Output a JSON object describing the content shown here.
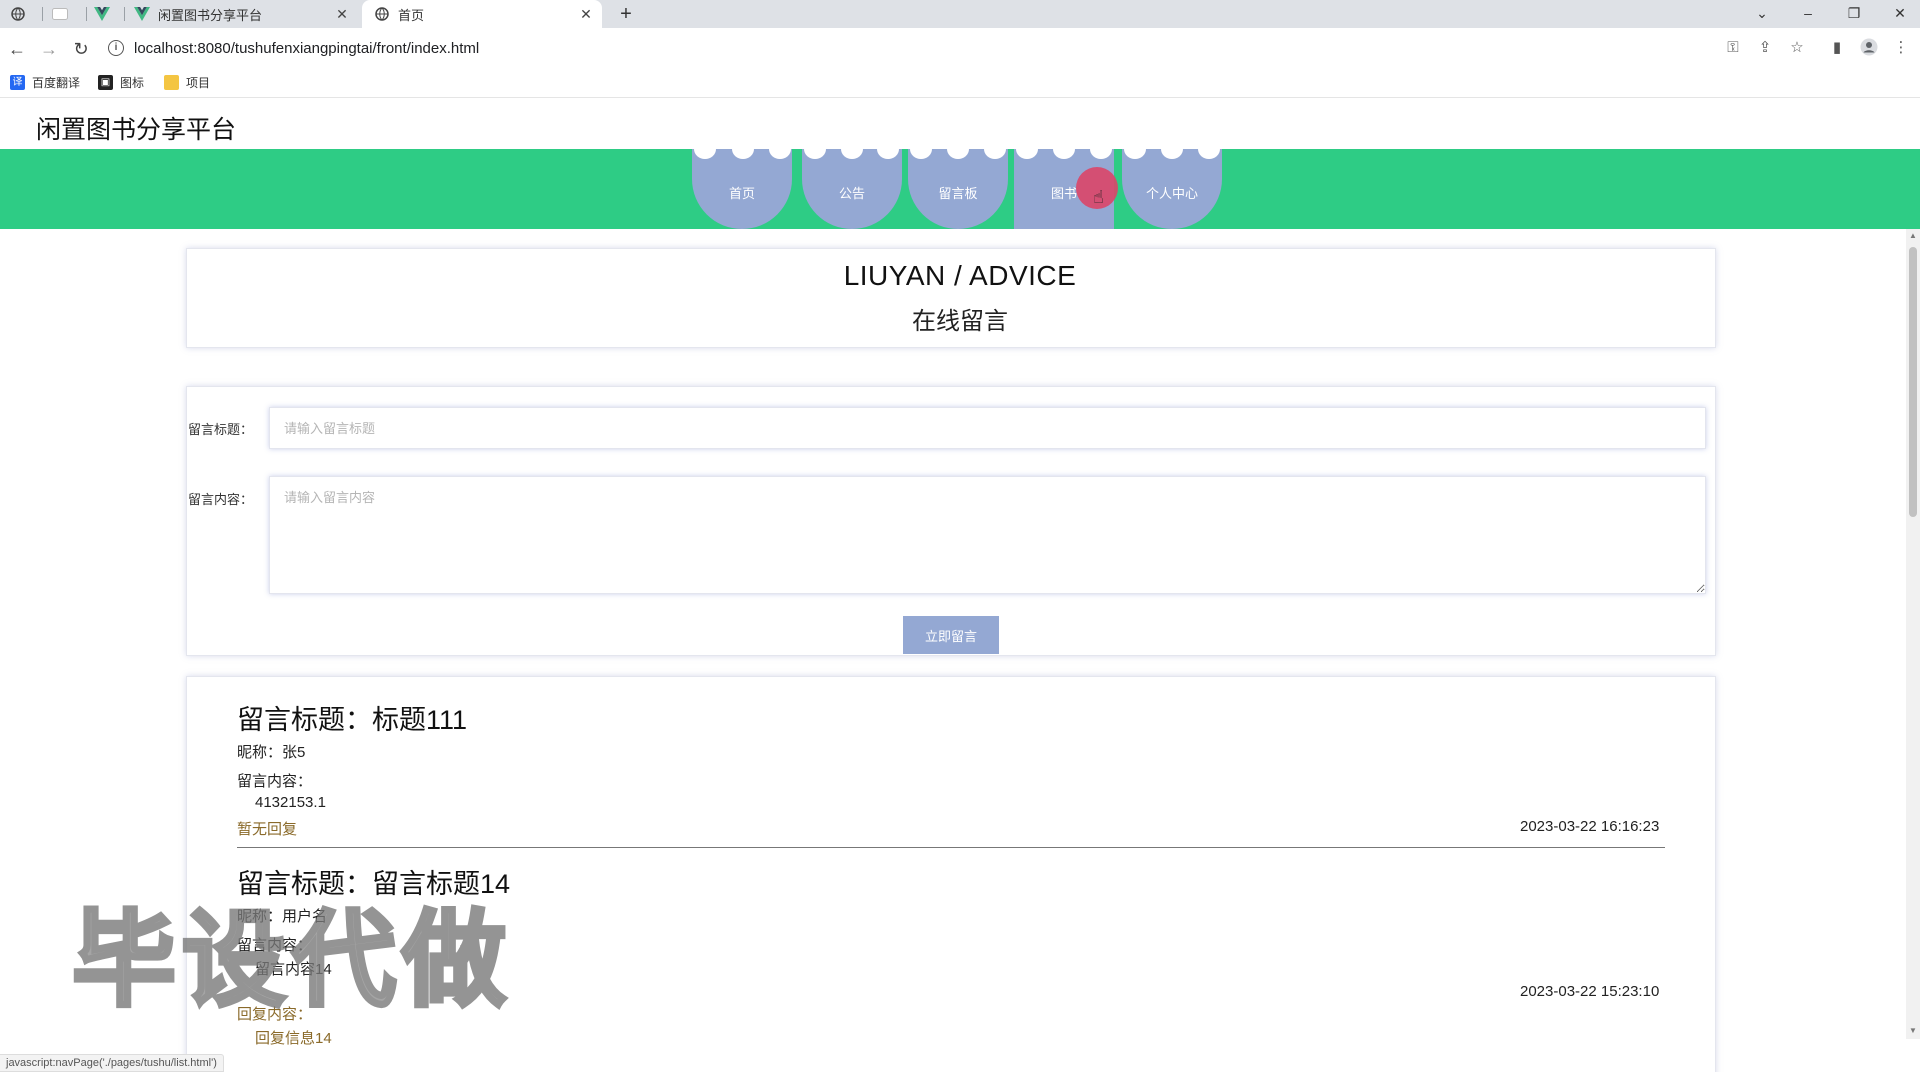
{
  "browser": {
    "tabs": [
      {
        "label": "",
        "icon": "globe-icon"
      },
      {
        "label": "",
        "icon": "blank-page-icon"
      },
      {
        "label": "",
        "icon": "vue-logo-icon"
      },
      {
        "label": "闲置图书分享平台",
        "icon": "vue-logo-icon"
      },
      {
        "label": "首页",
        "icon": "globe-icon",
        "active": true
      }
    ],
    "url": "localhost:8080/tushufenxiangpingtai/front/index.html",
    "bookmarks": [
      {
        "label": "百度翻译",
        "icon": "translate-icon",
        "color": "#2468f2"
      },
      {
        "label": "图标",
        "icon": "image-icon",
        "color": "#222222"
      },
      {
        "label": "项目",
        "icon": "folder-icon",
        "color": "#f4c542"
      }
    ],
    "status_text": "javascript:navPage('./pages/tushu/list.html')"
  },
  "site": {
    "title": "闲置图书分享平台",
    "nav": [
      {
        "label": "首页"
      },
      {
        "label": "公告"
      },
      {
        "label": "留言板"
      },
      {
        "label": "图书"
      },
      {
        "label": "个人中心"
      }
    ],
    "nav_color": "#94a8d3",
    "band_color": "#2ecc85",
    "hover_color": "#d9486a"
  },
  "header": {
    "title_en": "LIUYAN / ADVICE",
    "title_cn": "在线留言"
  },
  "form": {
    "title_label": "留言标题：",
    "title_placeholder": "请输入留言标题",
    "content_label": "留言内容：",
    "content_placeholder": "请输入留言内容",
    "submit_label": "立即留言"
  },
  "messages": [
    {
      "title": "留言标题：标题111",
      "nickname": "昵称：张5",
      "content_label": "留言内容：",
      "content": "4132153.1",
      "reply": "暂无回复",
      "date": "2023-03-22 16:16:23"
    },
    {
      "title": "留言标题：留言标题14",
      "nickname": "昵称：用户名",
      "content_label": "留言内容：",
      "content": "留言内容14",
      "reply_label": "回复内容：",
      "reply": "回复信息14",
      "date": "2023-03-22 15:23:10"
    }
  ],
  "watermark": "毕设代做"
}
